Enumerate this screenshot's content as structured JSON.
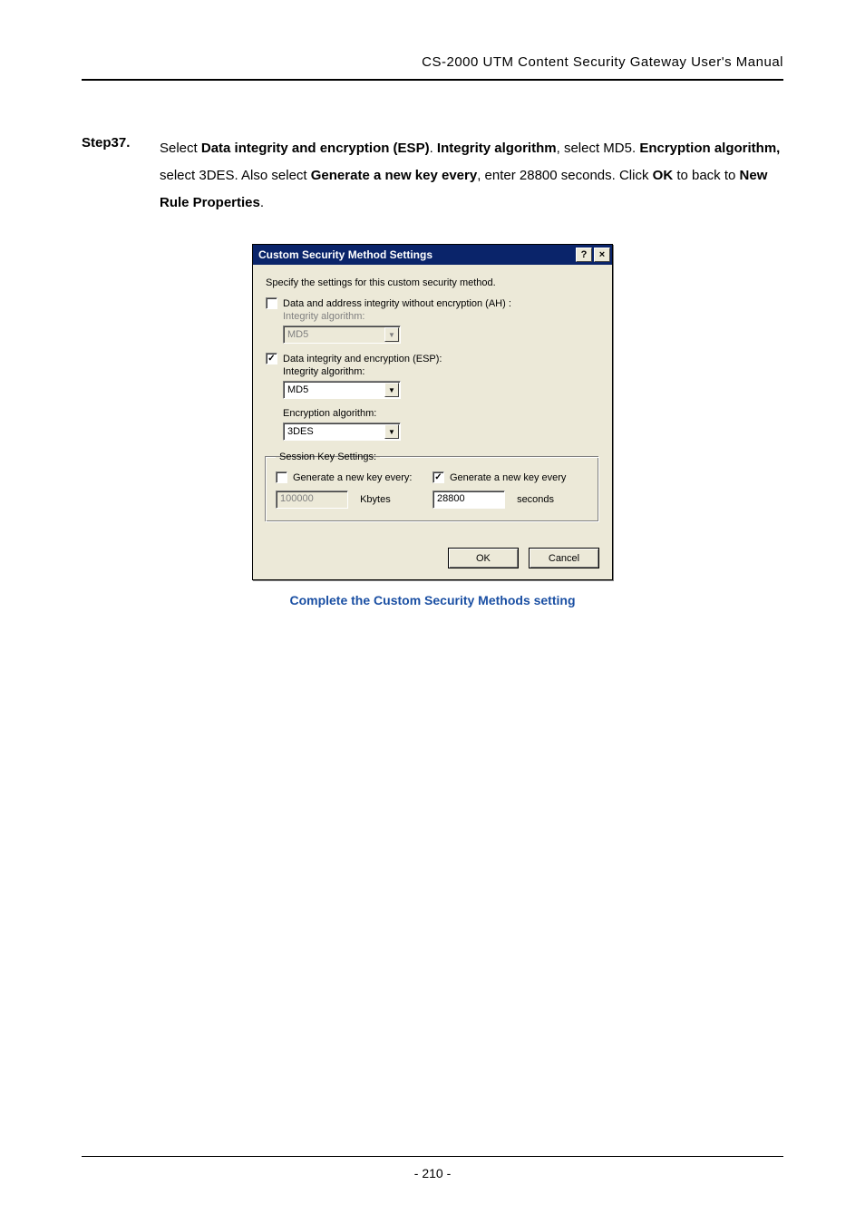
{
  "header": "CS-2000 UTM Content Security Gateway User's Manual",
  "step": {
    "label": "Step37.",
    "text_parts": {
      "p0": "Select ",
      "b0": "Data integrity and encryption (ESP)",
      "p1": ". ",
      "b1": "Integrity algorithm",
      "p2": ", select MD5. ",
      "b2": "Encryption algorithm,",
      "p3": " select 3DES. Also select ",
      "b3": "Generate a new key every",
      "p4": ", enter 28800 seconds. Click ",
      "b4": "OK",
      "p5": " to back to ",
      "b5": "New Rule Properties",
      "p6": "."
    }
  },
  "dialog": {
    "title": "Custom Security Method Settings",
    "help_btn": "?",
    "close_btn": "×",
    "instruction": "Specify the settings for this custom security method.",
    "ah": {
      "checked": false,
      "label": "Data and address integrity without encryption (AH) :",
      "integrity_label": "Integrity algorithm:",
      "integrity_value": "MD5"
    },
    "esp": {
      "checked": true,
      "check_mark": "✓",
      "label": "Data integrity and encryption (ESP):",
      "integrity_label": "Integrity algorithm:",
      "integrity_value": "MD5",
      "encryption_label": "Encryption algorithm:",
      "encryption_value": "3DES"
    },
    "session": {
      "legend": "Session Key Settings:",
      "kbytes": {
        "checked": false,
        "label": "Generate a new key every:",
        "value": "100000",
        "unit": "Kbytes"
      },
      "seconds": {
        "checked": true,
        "check_mark": "✓",
        "label": "Generate a new key every",
        "value": "28800",
        "unit": "seconds"
      }
    },
    "buttons": {
      "ok": "OK",
      "cancel": "Cancel"
    }
  },
  "caption": "Complete the Custom Security Methods setting",
  "page_number": "- 210 -"
}
